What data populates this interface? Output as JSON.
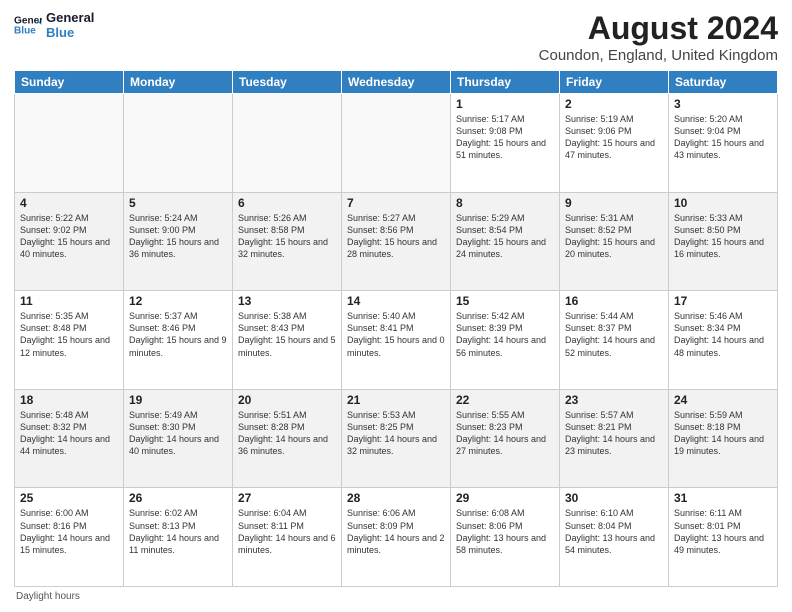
{
  "logo": {
    "line1": "General",
    "line2": "Blue",
    "arrow_color": "#2f7fc1"
  },
  "title": "August 2024",
  "subtitle": "Coundon, England, United Kingdom",
  "days_header": [
    "Sunday",
    "Monday",
    "Tuesday",
    "Wednesday",
    "Thursday",
    "Friday",
    "Saturday"
  ],
  "footer_note": "Daylight hours",
  "weeks": [
    [
      {
        "day": "",
        "sunrise": "",
        "sunset": "",
        "daylight": "",
        "empty": true
      },
      {
        "day": "",
        "sunrise": "",
        "sunset": "",
        "daylight": "",
        "empty": true
      },
      {
        "day": "",
        "sunrise": "",
        "sunset": "",
        "daylight": "",
        "empty": true
      },
      {
        "day": "",
        "sunrise": "",
        "sunset": "",
        "daylight": "",
        "empty": true
      },
      {
        "day": "1",
        "sunrise": "Sunrise: 5:17 AM",
        "sunset": "Sunset: 9:08 PM",
        "daylight": "Daylight: 15 hours and 51 minutes."
      },
      {
        "day": "2",
        "sunrise": "Sunrise: 5:19 AM",
        "sunset": "Sunset: 9:06 PM",
        "daylight": "Daylight: 15 hours and 47 minutes."
      },
      {
        "day": "3",
        "sunrise": "Sunrise: 5:20 AM",
        "sunset": "Sunset: 9:04 PM",
        "daylight": "Daylight: 15 hours and 43 minutes."
      }
    ],
    [
      {
        "day": "4",
        "sunrise": "Sunrise: 5:22 AM",
        "sunset": "Sunset: 9:02 PM",
        "daylight": "Daylight: 15 hours and 40 minutes."
      },
      {
        "day": "5",
        "sunrise": "Sunrise: 5:24 AM",
        "sunset": "Sunset: 9:00 PM",
        "daylight": "Daylight: 15 hours and 36 minutes."
      },
      {
        "day": "6",
        "sunrise": "Sunrise: 5:26 AM",
        "sunset": "Sunset: 8:58 PM",
        "daylight": "Daylight: 15 hours and 32 minutes."
      },
      {
        "day": "7",
        "sunrise": "Sunrise: 5:27 AM",
        "sunset": "Sunset: 8:56 PM",
        "daylight": "Daylight: 15 hours and 28 minutes."
      },
      {
        "day": "8",
        "sunrise": "Sunrise: 5:29 AM",
        "sunset": "Sunset: 8:54 PM",
        "daylight": "Daylight: 15 hours and 24 minutes."
      },
      {
        "day": "9",
        "sunrise": "Sunrise: 5:31 AM",
        "sunset": "Sunset: 8:52 PM",
        "daylight": "Daylight: 15 hours and 20 minutes."
      },
      {
        "day": "10",
        "sunrise": "Sunrise: 5:33 AM",
        "sunset": "Sunset: 8:50 PM",
        "daylight": "Daylight: 15 hours and 16 minutes."
      }
    ],
    [
      {
        "day": "11",
        "sunrise": "Sunrise: 5:35 AM",
        "sunset": "Sunset: 8:48 PM",
        "daylight": "Daylight: 15 hours and 12 minutes."
      },
      {
        "day": "12",
        "sunrise": "Sunrise: 5:37 AM",
        "sunset": "Sunset: 8:46 PM",
        "daylight": "Daylight: 15 hours and 9 minutes."
      },
      {
        "day": "13",
        "sunrise": "Sunrise: 5:38 AM",
        "sunset": "Sunset: 8:43 PM",
        "daylight": "Daylight: 15 hours and 5 minutes."
      },
      {
        "day": "14",
        "sunrise": "Sunrise: 5:40 AM",
        "sunset": "Sunset: 8:41 PM",
        "daylight": "Daylight: 15 hours and 0 minutes."
      },
      {
        "day": "15",
        "sunrise": "Sunrise: 5:42 AM",
        "sunset": "Sunset: 8:39 PM",
        "daylight": "Daylight: 14 hours and 56 minutes."
      },
      {
        "day": "16",
        "sunrise": "Sunrise: 5:44 AM",
        "sunset": "Sunset: 8:37 PM",
        "daylight": "Daylight: 14 hours and 52 minutes."
      },
      {
        "day": "17",
        "sunrise": "Sunrise: 5:46 AM",
        "sunset": "Sunset: 8:34 PM",
        "daylight": "Daylight: 14 hours and 48 minutes."
      }
    ],
    [
      {
        "day": "18",
        "sunrise": "Sunrise: 5:48 AM",
        "sunset": "Sunset: 8:32 PM",
        "daylight": "Daylight: 14 hours and 44 minutes."
      },
      {
        "day": "19",
        "sunrise": "Sunrise: 5:49 AM",
        "sunset": "Sunset: 8:30 PM",
        "daylight": "Daylight: 14 hours and 40 minutes."
      },
      {
        "day": "20",
        "sunrise": "Sunrise: 5:51 AM",
        "sunset": "Sunset: 8:28 PM",
        "daylight": "Daylight: 14 hours and 36 minutes."
      },
      {
        "day": "21",
        "sunrise": "Sunrise: 5:53 AM",
        "sunset": "Sunset: 8:25 PM",
        "daylight": "Daylight: 14 hours and 32 minutes."
      },
      {
        "day": "22",
        "sunrise": "Sunrise: 5:55 AM",
        "sunset": "Sunset: 8:23 PM",
        "daylight": "Daylight: 14 hours and 27 minutes."
      },
      {
        "day": "23",
        "sunrise": "Sunrise: 5:57 AM",
        "sunset": "Sunset: 8:21 PM",
        "daylight": "Daylight: 14 hours and 23 minutes."
      },
      {
        "day": "24",
        "sunrise": "Sunrise: 5:59 AM",
        "sunset": "Sunset: 8:18 PM",
        "daylight": "Daylight: 14 hours and 19 minutes."
      }
    ],
    [
      {
        "day": "25",
        "sunrise": "Sunrise: 6:00 AM",
        "sunset": "Sunset: 8:16 PM",
        "daylight": "Daylight: 14 hours and 15 minutes."
      },
      {
        "day": "26",
        "sunrise": "Sunrise: 6:02 AM",
        "sunset": "Sunset: 8:13 PM",
        "daylight": "Daylight: 14 hours and 11 minutes."
      },
      {
        "day": "27",
        "sunrise": "Sunrise: 6:04 AM",
        "sunset": "Sunset: 8:11 PM",
        "daylight": "Daylight: 14 hours and 6 minutes."
      },
      {
        "day": "28",
        "sunrise": "Sunrise: 6:06 AM",
        "sunset": "Sunset: 8:09 PM",
        "daylight": "Daylight: 14 hours and 2 minutes."
      },
      {
        "day": "29",
        "sunrise": "Sunrise: 6:08 AM",
        "sunset": "Sunset: 8:06 PM",
        "daylight": "Daylight: 13 hours and 58 minutes."
      },
      {
        "day": "30",
        "sunrise": "Sunrise: 6:10 AM",
        "sunset": "Sunset: 8:04 PM",
        "daylight": "Daylight: 13 hours and 54 minutes."
      },
      {
        "day": "31",
        "sunrise": "Sunrise: 6:11 AM",
        "sunset": "Sunset: 8:01 PM",
        "daylight": "Daylight: 13 hours and 49 minutes."
      }
    ]
  ]
}
